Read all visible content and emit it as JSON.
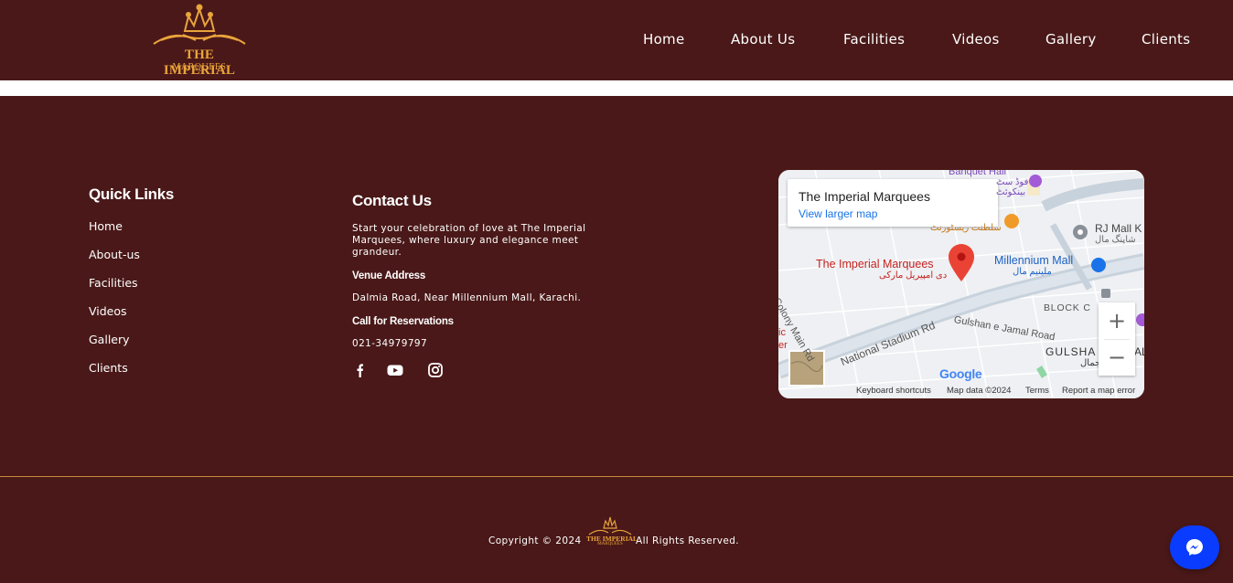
{
  "header": {
    "logo_line1": "THE IMPERIAL",
    "logo_line2": "MARQUEES",
    "nav": [
      "Home",
      "About Us",
      "Facilities",
      "Videos",
      "Gallery",
      "Clients"
    ]
  },
  "footer": {
    "quick_links_title": "Quick Links",
    "quick_links": [
      "Home",
      "About-us",
      "Facilities",
      "Videos",
      "Gallery",
      "Clients"
    ],
    "contact_title": "Contact Us",
    "contact_intro": "Start your celebration of love at The Imperial Marquees, where luxury and elegance meet grandeur.",
    "venue_label": "Venue Address",
    "venue_address": "Dalmia Road, Near Millennium Mall, Karachi.",
    "call_label": "Call for Reservations",
    "phone": "021-34979797",
    "social_icons": [
      "facebook-icon",
      "youtube-icon",
      "instagram-icon"
    ]
  },
  "map": {
    "place_title": "The Imperial Marquees",
    "larger_map_link": "View larger map",
    "pin_label": "The Imperial Marquees",
    "pin_label_urdu": "دی امپیریل مارکی",
    "labels": {
      "banquet_hall": "Banquet Hall",
      "rj_mall": "RJ Mall K",
      "rj_mall_urdu": "شاپنگ مال",
      "millennium_mall": "Millennium Mall",
      "millennium_mall_urdu": "ملینیم مال",
      "block_c": "BLOCK C",
      "gulshan_road": "Gulshan e Jamal Road",
      "stadium_road": "National Stadium Rd",
      "colony_road": "Colony Main Rd",
      "gulsha": "GULSHA",
      "gulsha_rest": "AL",
      "jamal_urdu": "جمال",
      "restaurant_urdu": "سلطنت ریسٹورنٹ",
      "food_urdu": "فوڈ سٹ",
      "banquet_urdu": "بینکوئٹ",
      "partial_ic": "ic",
      "partial_er": "er"
    },
    "zoom_in": "+",
    "zoom_out": "−",
    "google": "Google",
    "attribution": [
      "Keyboard shortcuts",
      "Map data ©2024",
      "Terms",
      "Report a map error"
    ]
  },
  "bottom": {
    "copyright_left": "Copyright © 2024",
    "copyright_right": "All Rights Reserved.",
    "mini_logo_line1": "THE IMPERIAL",
    "mini_logo_line2": "MARQUEES"
  },
  "colors": {
    "background": "#4a1818",
    "accent_gold": "#e9a43c",
    "messenger_blue": "#0a3cff"
  }
}
